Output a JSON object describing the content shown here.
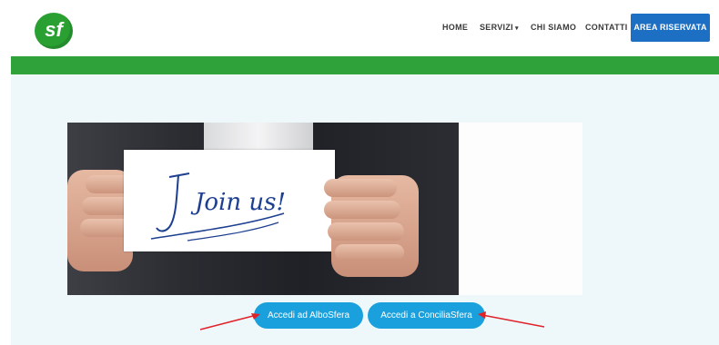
{
  "header": {
    "logo_text": "sf",
    "nav": {
      "home": "HOME",
      "servizi": "SERVIZI",
      "chi_siamo": "CHI SIAMO",
      "contatti": "CONTATTI"
    },
    "cta_label": "AREA RISERVATA"
  },
  "hero": {
    "card_text": "Join us!"
  },
  "actions": {
    "albosfera_label": "Accedi ad AlboSfera",
    "conciliasfera_label": "Accedi a ConciliaSfera"
  },
  "colors": {
    "brand_green": "#2fa33a",
    "nav_button_blue": "#1d6fc3",
    "action_button_blue": "#1aa0dc",
    "annotation_arrow": "#e0232a",
    "content_background": "#eef8fb"
  },
  "icons": {
    "dropdown": "caret-down-icon",
    "annotation": "red-arrow-icon"
  }
}
